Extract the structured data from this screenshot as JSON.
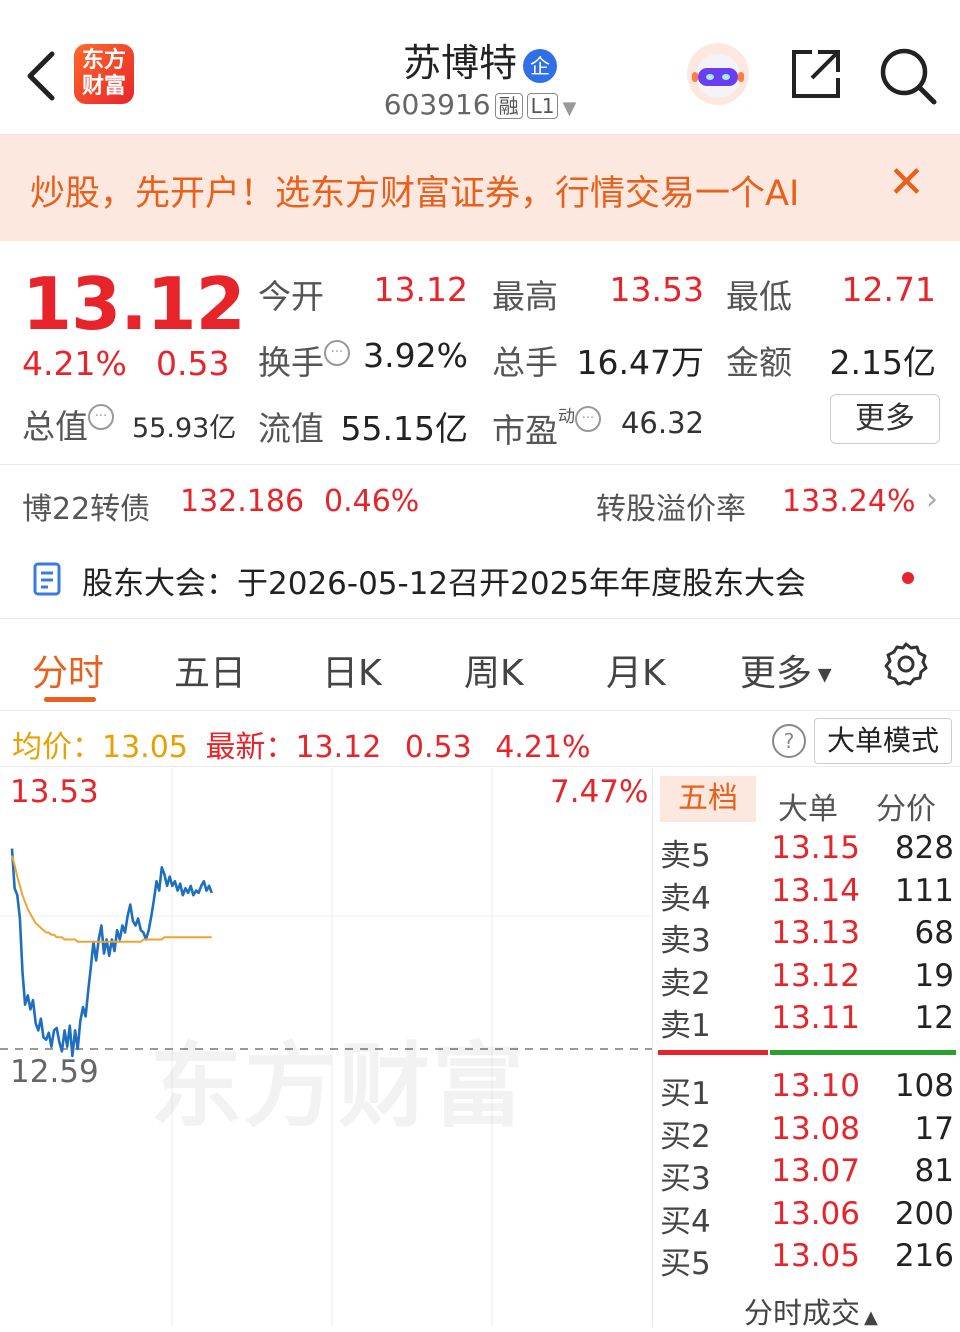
{
  "header": {
    "logo_text": "东方财富",
    "stock_name": "苏博特",
    "enterprise_badge": "企",
    "code": "603916",
    "margin_tag": "融",
    "level_tag": "L1"
  },
  "banner": {
    "text": "炒股，先开户！选东方财富证券，行情交易一个AI",
    "close_symbol": "✕"
  },
  "quote": {
    "price": "13.12",
    "change_pct": "4.21%",
    "change": "0.53",
    "open_label": "今开",
    "open": "13.12",
    "high_label": "最高",
    "high": "13.53",
    "low_label": "最低",
    "low": "12.71",
    "turnover_label": "换手",
    "turnover": "3.92%",
    "volume_label": "总手",
    "volume": "16.47万",
    "amount_label": "金额",
    "amount": "2.15亿",
    "mktcap_label": "总值",
    "mktcap": "55.93亿",
    "float_label": "流值",
    "float_cap": "55.15亿",
    "pe_label": "市盈",
    "pe_sup": "动",
    "pe": "46.32",
    "more_button": "更多"
  },
  "bond": {
    "name": "博22转债",
    "price": "132.186",
    "pct": "0.46%",
    "premium_label": "转股溢价率",
    "premium": "133.24%"
  },
  "notice": {
    "text": "股东大会：于2026-05-12召开2025年年度股东大会"
  },
  "tabs": [
    "分时",
    "五日",
    "日K",
    "周K",
    "月K",
    "更多"
  ],
  "chart_header": {
    "avg_label": "均价：",
    "avg": "13.05",
    "latest_label": "最新：",
    "latest": "13.12",
    "change": "0.53",
    "pct": "4.21%",
    "help_symbol": "?",
    "big_order_mode": "大单模式"
  },
  "chart_data": {
    "type": "line",
    "y_top_label": "13.53",
    "y_mid_label": "12.59",
    "right_top_pct": "7.47%",
    "ylim": [
      11.65,
      13.53
    ],
    "prev_close": 12.59,
    "grid": true,
    "watermark": "东方财富",
    "series": [
      {
        "color": "#1e6fbf",
        "values": [
          13.45,
          13.28,
          13.25,
          13.15,
          12.92,
          12.78,
          12.82,
          12.76,
          12.8,
          12.7,
          12.67,
          12.72,
          12.64,
          12.63,
          12.66,
          12.6,
          12.67,
          12.68,
          12.62,
          12.58,
          12.67,
          12.6,
          12.69,
          12.56,
          12.67,
          12.59,
          12.71,
          12.77,
          12.73,
          12.84,
          12.94,
          13.05,
          12.97,
          13.06,
          13.12,
          13.0,
          13.06,
          12.99,
          13.06,
          13.01,
          13.1,
          13.06,
          13.12,
          13.09,
          13.16,
          13.21,
          13.14,
          13.12,
          13.15,
          13.1,
          13.09,
          13.06,
          13.1,
          13.16,
          13.23,
          13.31,
          13.27,
          13.37,
          13.34,
          13.29,
          13.33,
          13.29,
          13.31,
          13.27,
          13.3,
          13.25,
          13.28,
          13.26,
          13.29,
          13.25,
          13.27,
          13.26,
          13.29,
          13.31,
          13.27,
          13.29,
          13.26
        ]
      },
      {
        "color": "#f0a330",
        "values": [
          13.42,
          13.38,
          13.33,
          13.29,
          13.25,
          13.22,
          13.19,
          13.17,
          13.15,
          13.13,
          13.12,
          13.11,
          13.1,
          13.09,
          13.09,
          13.08,
          13.08,
          13.07,
          13.07,
          13.07,
          13.06,
          13.06,
          13.06,
          13.06,
          13.06,
          13.05,
          13.05,
          13.05,
          13.05,
          13.05,
          13.05,
          13.05,
          13.05,
          13.05,
          13.05,
          13.05,
          13.05,
          13.05,
          13.05,
          13.05,
          13.05,
          13.05,
          13.05,
          13.05,
          13.05,
          13.05,
          13.05,
          13.05,
          13.05,
          13.05,
          13.06,
          13.06,
          13.06,
          13.06,
          13.06,
          13.06,
          13.06,
          13.06,
          13.07,
          13.07,
          13.07,
          13.07,
          13.07,
          13.07,
          13.07,
          13.07,
          13.07,
          13.07,
          13.07,
          13.07,
          13.07,
          13.07,
          13.07,
          13.07,
          13.07,
          13.07,
          13.07
        ]
      }
    ]
  },
  "order_book": {
    "tabs": [
      "五档",
      "大单",
      "分价"
    ],
    "sell": [
      {
        "label": "卖5",
        "price": "13.15",
        "vol": "828"
      },
      {
        "label": "卖4",
        "price": "13.14",
        "vol": "111"
      },
      {
        "label": "卖3",
        "price": "13.13",
        "vol": "68"
      },
      {
        "label": "卖2",
        "price": "13.12",
        "vol": "19"
      },
      {
        "label": "卖1",
        "price": "13.11",
        "vol": "12"
      }
    ],
    "buy": [
      {
        "label": "买1",
        "price": "13.10",
        "vol": "108"
      },
      {
        "label": "买2",
        "price": "13.08",
        "vol": "17"
      },
      {
        "label": "买3",
        "price": "13.07",
        "vol": "81"
      },
      {
        "label": "买4",
        "price": "13.06",
        "vol": "200"
      },
      {
        "label": "买5",
        "price": "13.05",
        "vol": "216"
      }
    ],
    "footer": "分时成交"
  },
  "colors": {
    "up": "#e8242b",
    "accent": "#e8601c",
    "price_line": "#1e6fbf",
    "avg_line": "#f0a330",
    "buy_bar": "#2ca02c"
  }
}
